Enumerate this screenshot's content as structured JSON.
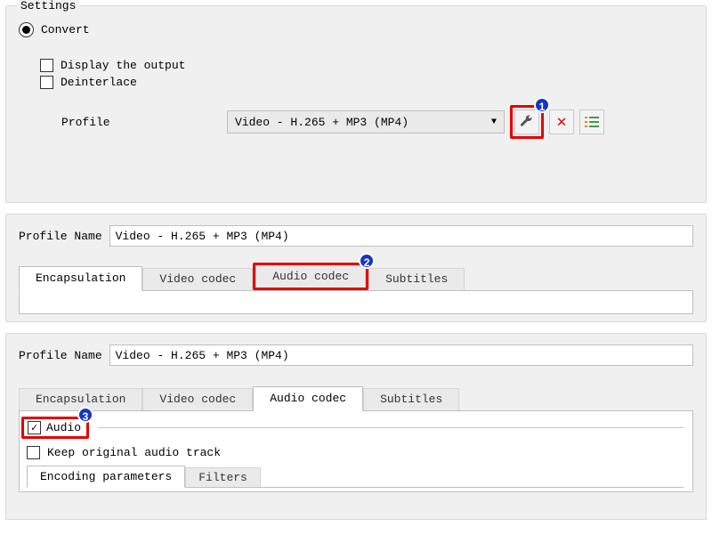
{
  "settings": {
    "title": "Settings",
    "convert_label": "Convert",
    "display_output_label": "Display the output",
    "deinterlace_label": "Deinterlace",
    "profile_label": "Profile",
    "profile_value": "Video - H.265 + MP3 (MP4)"
  },
  "profile_panel": {
    "name_label": "Profile Name",
    "name_value": "Video - H.265 + MP3 (MP4)",
    "tabs": {
      "encapsulation": "Encapsulation",
      "video_codec": "Video codec",
      "audio_codec": "Audio codec",
      "subtitles": "Subtitles"
    }
  },
  "profile_panel2": {
    "name_label": "Profile Name",
    "name_value": "Video - H.265 + MP3 (MP4)",
    "tabs": {
      "encapsulation": "Encapsulation",
      "video_codec": "Video codec",
      "audio_codec": "Audio codec",
      "subtitles": "Subtitles"
    },
    "audio_check": "Audio",
    "keep_original": "Keep original audio track",
    "subtabs": {
      "encoding": "Encoding parameters",
      "filters": "Filters"
    }
  },
  "callouts": {
    "one": "1",
    "two": "2",
    "three": "3"
  }
}
